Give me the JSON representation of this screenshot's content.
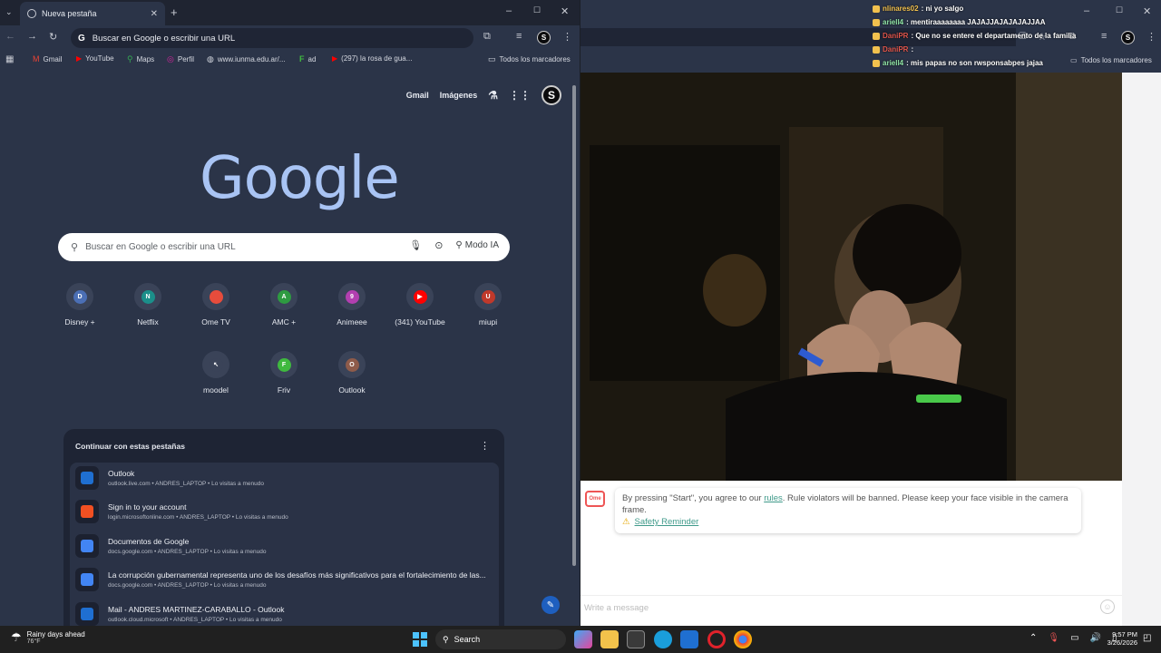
{
  "left_browser": {
    "tab_title": "Nueva pestaña",
    "omnibox_text": "Buscar en Google o escribir una URL",
    "bookmarks": [
      {
        "label": "Gmail",
        "icon": "gmail-icon",
        "color": "#ea4335"
      },
      {
        "label": "YouTube",
        "icon": "youtube-icon",
        "color": "#ff0000"
      },
      {
        "label": "Maps",
        "icon": "maps-icon",
        "color": "#34a853"
      },
      {
        "label": "Perfil",
        "icon": "instagram-icon",
        "color": "#d6249f"
      },
      {
        "label": "www.iunma.edu.ar/...",
        "icon": "globe-icon",
        "color": "#c9ccd4"
      },
      {
        "label": "ad",
        "icon": "friv-icon",
        "color": "#3fb93f"
      },
      {
        "label": "(297) la rosa de gua...",
        "icon": "youtube-icon",
        "color": "#ff0000"
      }
    ],
    "all_bookmarks": "Todos los marcadores",
    "top_links": {
      "gmail": "Gmail",
      "images": "Imágenes",
      "avatar": "S"
    },
    "logo": "Google",
    "search_placeholder": "Buscar en Google o escribir una URL",
    "ai_mode": "Modo IA",
    "shortcuts": [
      {
        "label": "Disney +",
        "letter": "D",
        "color": "#4b6fb5"
      },
      {
        "label": "Netflix",
        "letter": "N",
        "color": "#1b8f8a"
      },
      {
        "label": "Ome TV",
        "letter": "",
        "color": "#e74c3c"
      },
      {
        "label": "AMC +",
        "letter": "A",
        "color": "#2e9b41"
      },
      {
        "label": "Animeee",
        "letter": "9",
        "color": "#b23fb0"
      },
      {
        "label": "(341) YouTube",
        "letter": "▶",
        "color": "#ff0000"
      },
      {
        "label": "miupi",
        "letter": "U",
        "color": "#c0392b"
      },
      {
        "label": "moodel",
        "letter": "↖",
        "color": "#3a4358"
      },
      {
        "label": "Friv",
        "letter": "F",
        "color": "#3fb93f"
      },
      {
        "label": "Outlook",
        "letter": "O",
        "color": "#8e5b4a"
      }
    ],
    "continue_title": "Continuar con estas pestañas",
    "continue_tabs": [
      {
        "title": "Outlook",
        "sub": "outlook.live.com • ANDRES_LAPTOP • Lo visitas a menudo",
        "icon": "outlook-icon"
      },
      {
        "title": "Sign in to your account",
        "sub": "login.microsoftonline.com • ANDRES_LAPTOP • Lo visitas a menudo",
        "icon": "microsoft-icon"
      },
      {
        "title": "Documentos de Google",
        "sub": "docs.google.com • ANDRES_LAPTOP • Lo visitas a menudo",
        "icon": "docs-icon"
      },
      {
        "title": "La corrupción gubernamental representa uno de los desafíos más significativos para el fortalecimiento de las...",
        "sub": "docs.google.com • ANDRES_LAPTOP • Lo visitas a menudo",
        "icon": "docs-icon"
      },
      {
        "title": "Mail - ANDRES MARTINEZ-CARABALLO - Outlook",
        "sub": "outlook.cloud.microsoft • ANDRES_LAPTOP • Lo visitas a menudo",
        "icon": "outlook-icon"
      }
    ]
  },
  "right_browser": {
    "all_bookmarks": "Todos los marcadores",
    "notice_text_1": "By pressing \"Start\", you agree to our ",
    "notice_link": "rules",
    "notice_text_2": ". Rule violators will be banned. Please keep your face visible in the camera frame.",
    "safety_reminder": "Safety Reminder",
    "message_placeholder": "Write a message"
  },
  "chat": [
    {
      "user": "nlinares02",
      "text": ": ni yo salgo",
      "color": "#f2c14e"
    },
    {
      "user": "ariell4",
      "text": ": mentiraaaaaaaa JAJAJJAJAJAJAJJAA",
      "color": "#8fe3a5"
    },
    {
      "user": "DaniPR",
      "text": ": Que no se entere el departamento de la familia",
      "color": "#e0554b"
    },
    {
      "user": "DaniPR",
      "text": ":",
      "color": "#e0554b"
    },
    {
      "user": "ariell4",
      "text": ": mis papas no son rwsponsabpes jajaa",
      "color": "#8fe3a5"
    }
  ],
  "taskbar": {
    "weather_title": "Rainy days ahead",
    "weather_temp": "76°F",
    "search": "Search",
    "time": "9:57 PM",
    "date": "3/26/2026"
  }
}
